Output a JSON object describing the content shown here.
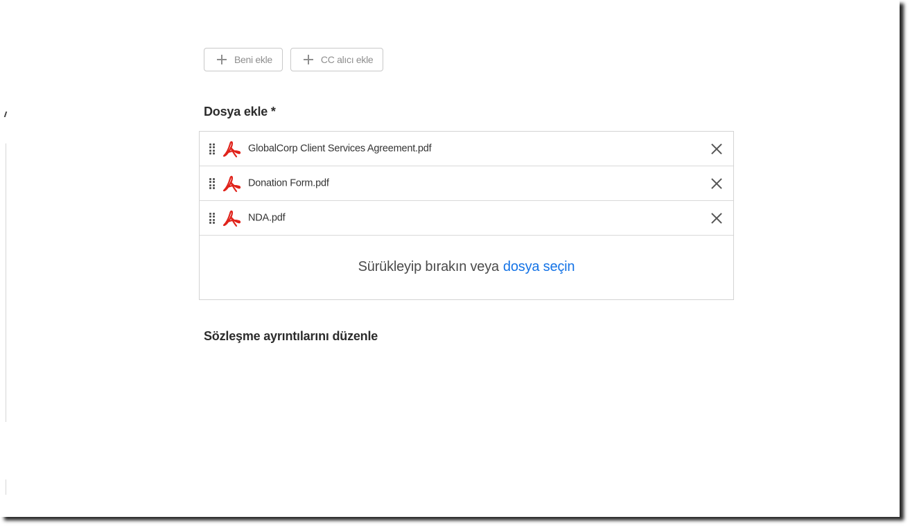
{
  "recipients": {
    "add_me_label": "Beni ekle",
    "add_cc_label": "CC alıcı ekle"
  },
  "files": {
    "title": "Dosya ekle *",
    "items": [
      {
        "name": "GlobalCorp Client Services Agreement.pdf",
        "icon": "pdf-icon"
      },
      {
        "name": "Donation Form.pdf",
        "icon": "pdf-icon"
      },
      {
        "name": "NDA.pdf",
        "icon": "pdf-icon"
      }
    ],
    "drop_text": "Sürükleyip bırakın veya",
    "choose_link": "dosya seçin"
  },
  "details": {
    "title": "Sözleşme ayrıntılarını düzenle"
  },
  "colors": {
    "link": "#1473e6",
    "pdf_red": "#e0231b",
    "border": "#d3d3d3"
  }
}
